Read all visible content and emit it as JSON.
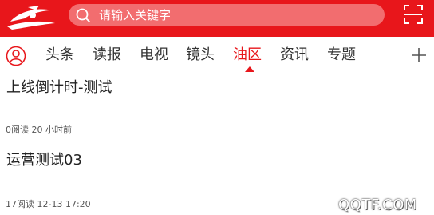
{
  "header": {
    "search_placeholder": "请输入关键字",
    "brand_color": "#e8161b"
  },
  "nav": {
    "tabs": [
      {
        "label": "头条",
        "active": false
      },
      {
        "label": "读报",
        "active": false
      },
      {
        "label": "电视",
        "active": false
      },
      {
        "label": "镜头",
        "active": false
      },
      {
        "label": "油区",
        "active": true
      },
      {
        "label": "资讯",
        "active": false
      },
      {
        "label": "专题",
        "active": false
      }
    ],
    "icons": {
      "profile": "user-circle-icon",
      "add": "plus-icon",
      "search": "search-icon",
      "scan": "scan-icon"
    }
  },
  "articles": [
    {
      "title": "上线倒计时-测试",
      "meta": "0阅读 20 小时前"
    },
    {
      "title": "运营测试03",
      "meta": "17阅读 12-13 17:20"
    }
  ],
  "watermark": "QQTF.COM"
}
